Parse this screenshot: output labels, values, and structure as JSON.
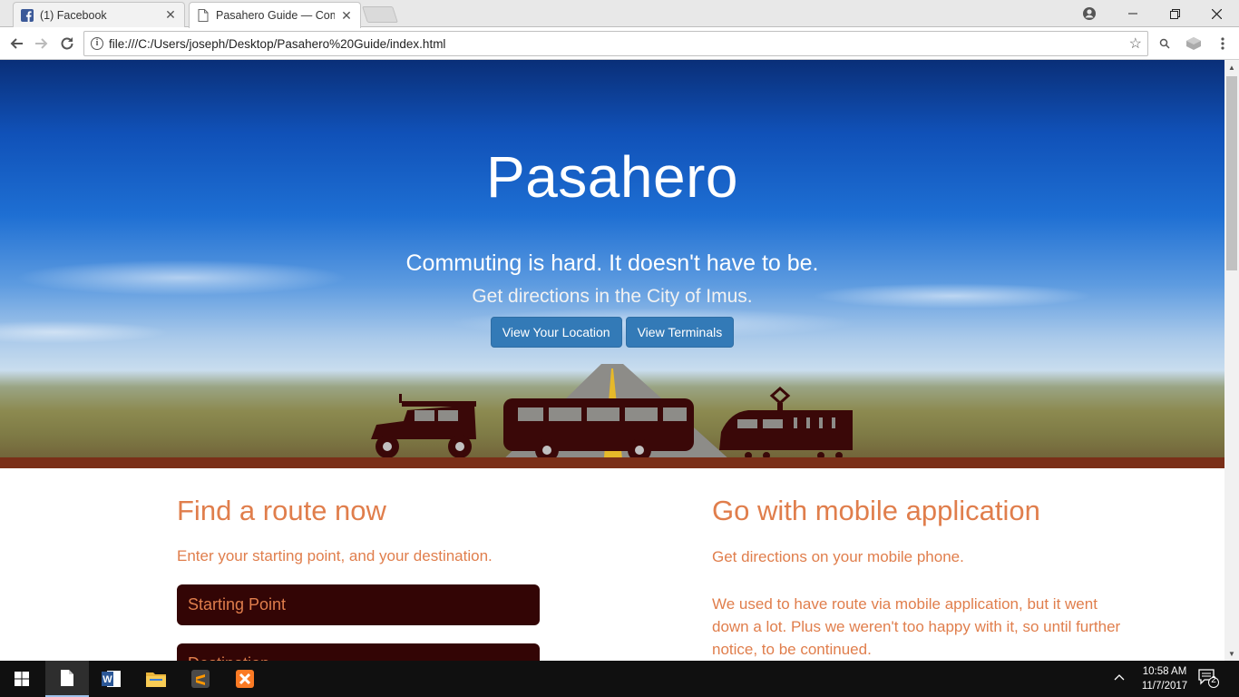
{
  "browser": {
    "tabs": [
      {
        "title": "(1) Facebook",
        "active": false
      },
      {
        "title": "Pasahero Guide — Comm",
        "active": true
      }
    ],
    "url": "file:///C:/Users/joseph/Desktop/Pasahero%20Guide/index.html"
  },
  "hero": {
    "title": "Pasahero",
    "tagline": "Commuting is hard. It doesn't have to be.",
    "subtagline": "Get directions in the City of Imus.",
    "buttons": {
      "location": "View Your Location",
      "terminals": "View Terminals"
    }
  },
  "find_route": {
    "heading": "Find a route now",
    "description": "Enter your starting point, and your destination.",
    "starting_point": "Starting Point",
    "destination": "Destination"
  },
  "mobile": {
    "heading": "Go with mobile application",
    "line1": "Get directions on your mobile phone.",
    "line2": "We used to have route via mobile application, but it went down a lot. Plus we weren't too happy with it, so until further notice, to be continued."
  },
  "taskbar": {
    "time": "10:58 AM",
    "date": "11/7/2017",
    "notification_count": "2"
  },
  "colors": {
    "accent": "#e07e4c",
    "field_bg": "#330505",
    "button_bg": "#337ab7",
    "ground": "#7a2f18"
  }
}
